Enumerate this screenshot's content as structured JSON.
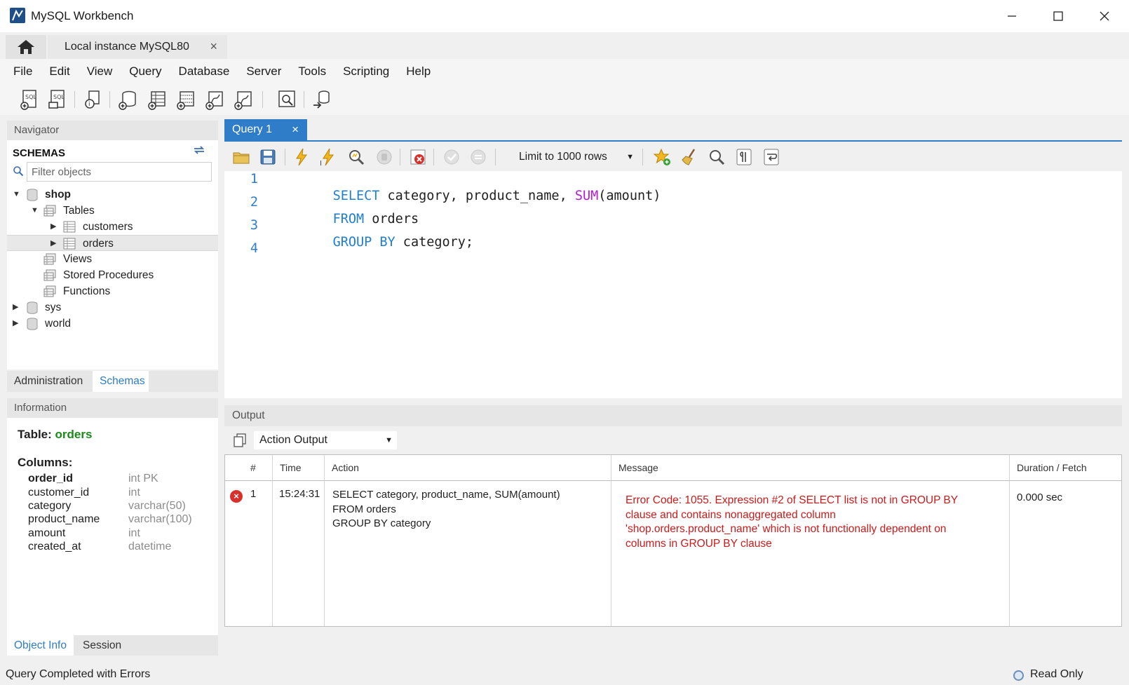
{
  "window": {
    "title": "MySQL Workbench",
    "controls": {
      "minimize": "—",
      "maximize": "☐",
      "close": "✕"
    }
  },
  "tabs": {
    "home_icon": "home-icon",
    "instance_tab": {
      "label": "Local instance MySQL80",
      "close": "×"
    }
  },
  "menu": [
    "File",
    "Edit",
    "View",
    "Query",
    "Database",
    "Server",
    "Tools",
    "Scripting",
    "Help"
  ],
  "navigator": {
    "header": "Navigator",
    "schemas_title": "SCHEMAS",
    "filter_placeholder": "Filter objects",
    "tree": {
      "shop": "shop",
      "tables": "Tables",
      "customers": "customers",
      "orders": "orders",
      "views": "Views",
      "stored_procedures": "Stored Procedures",
      "functions": "Functions",
      "sys": "sys",
      "world": "world"
    }
  },
  "left_tabs": {
    "administration": "Administration",
    "schemas": "Schemas"
  },
  "information": {
    "header": "Information",
    "table_label": "Table:",
    "table_name": "orders",
    "columns_label": "Columns:",
    "columns": [
      {
        "name": "order_id",
        "type": "int PK"
      },
      {
        "name": "customer_id",
        "type": "int"
      },
      {
        "name": "category",
        "type": "varchar(50)"
      },
      {
        "name": "product_name",
        "type": "varchar(100)"
      },
      {
        "name": "amount",
        "type": "int"
      },
      {
        "name": "created_at",
        "type": "datetime"
      }
    ]
  },
  "bottom_left_tabs": {
    "object_info": "Object Info",
    "session": "Session"
  },
  "query_tab": {
    "label": "Query 1",
    "close": "×"
  },
  "editor_toolbar": {
    "limit": "Limit to 1000 rows"
  },
  "editor": {
    "line_numbers": [
      "1",
      "2",
      "3",
      "4"
    ],
    "lines": [
      [
        {
          "t": "SELECT",
          "c": "kw"
        },
        {
          "t": " category, product_name, ",
          "c": ""
        },
        {
          "t": "SUM",
          "c": "fn"
        },
        {
          "t": "(amount)",
          "c": ""
        }
      ],
      [
        {
          "t": "FROM",
          "c": "kw"
        },
        {
          "t": " orders",
          "c": ""
        }
      ],
      [
        {
          "t": "GROUP BY",
          "c": "kw"
        },
        {
          "t": " category;",
          "c": ""
        }
      ],
      []
    ]
  },
  "output": {
    "header": "Output",
    "selector": "Action Output",
    "columns": {
      "num": "#",
      "time": "Time",
      "action": "Action",
      "message": "Message",
      "duration": "Duration / Fetch"
    },
    "row": {
      "num": "1",
      "time": "15:24:31",
      "action_lines": [
        "SELECT category, product_name, SUM(amount)",
        "FROM orders",
        "GROUP BY category"
      ],
      "message_lines": [
        "Error Code: 1055. Expression #2 of SELECT list is not in GROUP BY",
        "clause and contains nonaggregated column",
        "'shop.orders.product_name' which is not functionally dependent on",
        "columns in GROUP BY clause"
      ],
      "duration": "0.000 sec"
    }
  },
  "status": {
    "text": "Query Completed with Errors",
    "mode": "Read Only"
  },
  "colors": {
    "accent": "#2f7cc9",
    "error": "#cc1a1a",
    "keyword": "#1f7fcf",
    "function": "#b41cd6",
    "table_name": "#1a8a1a"
  }
}
